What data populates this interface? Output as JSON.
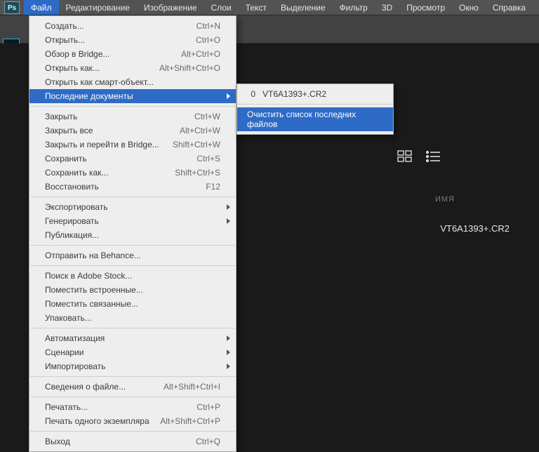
{
  "menubar": {
    "items": [
      "Файл",
      "Редактирование",
      "Изображение",
      "Слои",
      "Текст",
      "Выделение",
      "Фильтр",
      "3D",
      "Просмотр",
      "Окно",
      "Справка"
    ],
    "active_index": 0,
    "app_badge": "Ps"
  },
  "right_panel": {
    "header_name": "ИМЯ",
    "file": "VT6A1393+.CR2"
  },
  "dropdown": {
    "groups": [
      [
        {
          "label": "Создать...",
          "shortcut": "Ctrl+N"
        },
        {
          "label": "Открыть...",
          "shortcut": "Ctrl+O"
        },
        {
          "label": "Обзор в Bridge...",
          "shortcut": "Alt+Ctrl+O"
        },
        {
          "label": "Открыть как...",
          "shortcut": "Alt+Shift+Ctrl+O"
        },
        {
          "label": "Открыть как смарт-объект..."
        },
        {
          "label": "Последние документы",
          "submenu": true,
          "highlighted": true
        }
      ],
      [
        {
          "label": "Закрыть",
          "shortcut": "Ctrl+W"
        },
        {
          "label": "Закрыть все",
          "shortcut": "Alt+Ctrl+W"
        },
        {
          "label": "Закрыть и перейти в Bridge...",
          "shortcut": "Shift+Ctrl+W"
        },
        {
          "label": "Сохранить",
          "shortcut": "Ctrl+S"
        },
        {
          "label": "Сохранить как...",
          "shortcut": "Shift+Ctrl+S"
        },
        {
          "label": "Восстановить",
          "shortcut": "F12"
        }
      ],
      [
        {
          "label": "Экспортировать",
          "submenu": true
        },
        {
          "label": "Генерировать",
          "submenu": true
        },
        {
          "label": "Публикация..."
        }
      ],
      [
        {
          "label": "Отправить на Behance..."
        }
      ],
      [
        {
          "label": "Поиск в Adobe Stock..."
        },
        {
          "label": "Поместить встроенные..."
        },
        {
          "label": "Поместить связанные..."
        },
        {
          "label": "Упаковать..."
        }
      ],
      [
        {
          "label": "Автоматизация",
          "submenu": true
        },
        {
          "label": "Сценарии",
          "submenu": true
        },
        {
          "label": "Импортировать",
          "submenu": true
        }
      ],
      [
        {
          "label": "Сведения о файле...",
          "shortcut": "Alt+Shift+Ctrl+I"
        }
      ],
      [
        {
          "label": "Печатать...",
          "shortcut": "Ctrl+P"
        },
        {
          "label": "Печать одного экземпляра",
          "shortcut": "Alt+Shift+Ctrl+P"
        }
      ],
      [
        {
          "label": "Выход",
          "shortcut": "Ctrl+Q"
        }
      ]
    ]
  },
  "submenu": {
    "recent": {
      "index": "0",
      "name": "VT6A1393+.CR2"
    },
    "clear": "Очистить список последних файлов"
  }
}
